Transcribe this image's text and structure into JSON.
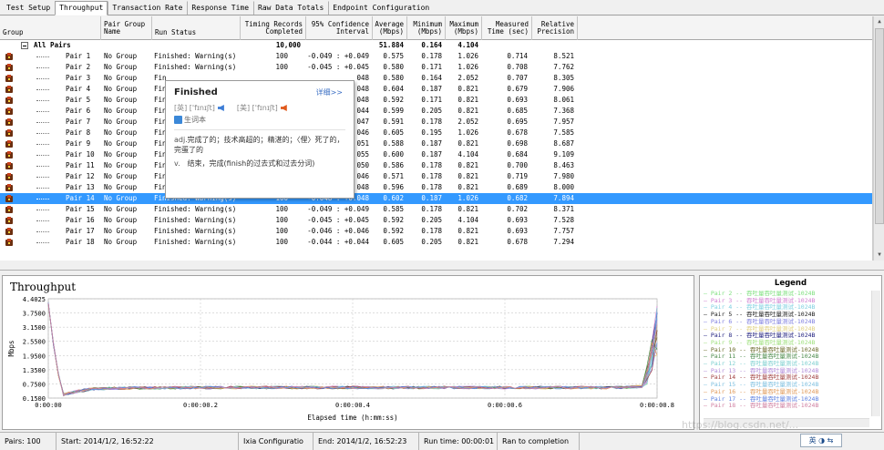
{
  "tabs": [
    "Test Setup",
    "Throughput",
    "Transaction Rate",
    "Response Time",
    "Raw Data Totals",
    "Endpoint Configuration"
  ],
  "columns": {
    "group": "Group",
    "pair_group_name": [
      "Pair Group",
      "Name"
    ],
    "run_status": "Run Status",
    "timing_records": [
      "Timing Records",
      "Completed"
    ],
    "confidence": [
      "95% Confidence",
      "Interval"
    ],
    "average": [
      "Average",
      "(Mbps)"
    ],
    "minimum": [
      "Minimum",
      "(Mbps)"
    ],
    "maximum": [
      "Maximum",
      "(Mbps)"
    ],
    "measured_time": [
      "Measured",
      "Time (sec)"
    ],
    "relative_precision": [
      "Relative",
      "Precision"
    ]
  },
  "all_pairs": {
    "label": "All Pairs",
    "records": "10,000",
    "average": "51.884",
    "minimum": "0.164",
    "maximum": "4.104"
  },
  "rows": [
    {
      "pair": "Pair 1",
      "group": "No Group",
      "status": "Finished: Warning(s)",
      "records": "100",
      "ci": "-0.049 : +0.049",
      "avg": "0.575",
      "min": "0.178",
      "max": "1.026",
      "time": "0.714",
      "prec": "8.521"
    },
    {
      "pair": "Pair 2",
      "group": "No Group",
      "status": "Finished: Warning(s)",
      "records": "100",
      "ci": "-0.045 : +0.045",
      "avg": "0.580",
      "min": "0.171",
      "max": "1.026",
      "time": "0.708",
      "prec": "7.762"
    },
    {
      "pair": "Pair 3",
      "group": "No Group",
      "status": "Fin",
      "records": "",
      "ci": "048",
      "avg": "0.580",
      "min": "0.164",
      "max": "2.052",
      "time": "0.707",
      "prec": "8.305"
    },
    {
      "pair": "Pair 4",
      "group": "No Group",
      "status": "Fin",
      "records": "",
      "ci": "048",
      "avg": "0.604",
      "min": "0.187",
      "max": "0.821",
      "time": "0.679",
      "prec": "7.906"
    },
    {
      "pair": "Pair 5",
      "group": "No Group",
      "status": "Fin",
      "records": "",
      "ci": "048",
      "avg": "0.592",
      "min": "0.171",
      "max": "0.821",
      "time": "0.693",
      "prec": "8.061"
    },
    {
      "pair": "Pair 6",
      "group": "No Group",
      "status": "Fin",
      "records": "",
      "ci": "044",
      "avg": "0.599",
      "min": "0.205",
      "max": "0.821",
      "time": "0.685",
      "prec": "7.368"
    },
    {
      "pair": "Pair 7",
      "group": "No Group",
      "status": "Fin",
      "records": "",
      "ci": "047",
      "avg": "0.591",
      "min": "0.178",
      "max": "2.052",
      "time": "0.695",
      "prec": "7.957"
    },
    {
      "pair": "Pair 8",
      "group": "No Group",
      "status": "Fin",
      "records": "",
      "ci": "046",
      "avg": "0.605",
      "min": "0.195",
      "max": "1.026",
      "time": "0.678",
      "prec": "7.585"
    },
    {
      "pair": "Pair 9",
      "group": "No Group",
      "status": "Fin",
      "records": "",
      "ci": "051",
      "avg": "0.588",
      "min": "0.187",
      "max": "0.821",
      "time": "0.698",
      "prec": "8.687"
    },
    {
      "pair": "Pair 10",
      "group": "No Group",
      "status": "Fin",
      "records": "",
      "ci": "055",
      "avg": "0.600",
      "min": "0.187",
      "max": "4.104",
      "time": "0.684",
      "prec": "9.109"
    },
    {
      "pair": "Pair 11",
      "group": "No Group",
      "status": "Fin",
      "records": "",
      "ci": "050",
      "avg": "0.586",
      "min": "0.178",
      "max": "0.821",
      "time": "0.700",
      "prec": "8.463"
    },
    {
      "pair": "Pair 12",
      "group": "No Group",
      "status": "Fin",
      "records": "",
      "ci": "046",
      "avg": "0.571",
      "min": "0.178",
      "max": "0.821",
      "time": "0.719",
      "prec": "7.980"
    },
    {
      "pair": "Pair 13",
      "group": "No Group",
      "status": "Fin",
      "records": "",
      "ci": "048",
      "avg": "0.596",
      "min": "0.178",
      "max": "0.821",
      "time": "0.689",
      "prec": "8.000"
    },
    {
      "pair": "Pair 14",
      "group": "No Group",
      "status": "Finished: Warning(s)",
      "records": "100",
      "ci": "-0.048 : +0.048",
      "avg": "0.602",
      "min": "0.187",
      "max": "1.026",
      "time": "0.682",
      "prec": "7.894",
      "selected": true
    },
    {
      "pair": "Pair 15",
      "group": "No Group",
      "status": "Finished: Warning(s)",
      "records": "100",
      "ci": "-0.049 : +0.049",
      "avg": "0.585",
      "min": "0.178",
      "max": "0.821",
      "time": "0.702",
      "prec": "8.371"
    },
    {
      "pair": "Pair 16",
      "group": "No Group",
      "status": "Finished: Warning(s)",
      "records": "100",
      "ci": "-0.045 : +0.045",
      "avg": "0.592",
      "min": "0.205",
      "max": "4.104",
      "time": "0.693",
      "prec": "7.528"
    },
    {
      "pair": "Pair 17",
      "group": "No Group",
      "status": "Finished: Warning(s)",
      "records": "100",
      "ci": "-0.046 : +0.046",
      "avg": "0.592",
      "min": "0.178",
      "max": "0.821",
      "time": "0.693",
      "prec": "7.757"
    },
    {
      "pair": "Pair 18",
      "group": "No Group",
      "status": "Finished: Warning(s)",
      "records": "100",
      "ci": "-0.044 : +0.044",
      "avg": "0.605",
      "min": "0.205",
      "max": "0.821",
      "time": "0.678",
      "prec": "7.294"
    }
  ],
  "tooltip": {
    "word": "Finished",
    "more": "详细>>",
    "uk": "[英] ['fɪnɪʃt]",
    "us": "[美] ['fɪnɪʃt]",
    "vocab": "生词本",
    "adj_pos": "adj.",
    "adj_def": "完成了的；技术高超的；精湛的；〈俚〉死了的，完蛋了的",
    "v_pos": "v.",
    "v_def": "结束，完成(finish的过去式和过去分词)"
  },
  "chart_data": {
    "type": "line",
    "title": "Throughput",
    "xlabel": "Elapsed time (h:mm:ss)",
    "ylabel": "Mbps",
    "y_ticks": [
      "4.4025",
      "3.7500",
      "3.1500",
      "2.5500",
      "1.9500",
      "1.3500",
      "0.7500",
      "0.1500"
    ],
    "x_ticks": [
      "0:00:00",
      "0:00:00.2",
      "0:00:00.4",
      "0:00:00.6",
      "0:00:00.8"
    ],
    "ylim": [
      0.15,
      4.4025
    ],
    "xlim": [
      0,
      0.8
    ],
    "series_profile": {
      "x": [
        0.0,
        0.01,
        0.02,
        0.04,
        0.06,
        0.1,
        0.2,
        0.3,
        0.4,
        0.5,
        0.6,
        0.65,
        0.7,
        0.75,
        0.78,
        0.79,
        0.8
      ],
      "y": [
        4.2,
        1.6,
        0.3,
        0.45,
        0.55,
        0.58,
        0.6,
        0.6,
        0.6,
        0.6,
        0.6,
        0.6,
        0.6,
        0.6,
        0.65,
        1.8,
        3.9
      ]
    },
    "grid": true
  },
  "legend": {
    "title": "Legend",
    "items": [
      {
        "label": "Pair 2 -- 吞吐量吞吐量测试-1024B",
        "color": "#7fe07f"
      },
      {
        "label": "Pair 3 -- 吞吐量吞吐量测试-1024B",
        "color": "#d07fd0"
      },
      {
        "label": "Pair 4 -- 吞吐量吞吐量测试-1024B",
        "color": "#7fd0e0"
      },
      {
        "label": "Pair 5 -- 吞吐量吞吐量测试-1024B",
        "color": "#202020"
      },
      {
        "label": "Pair 6 -- 吞吐量吞吐量测试-1024B",
        "color": "#7f7fe0"
      },
      {
        "label": "Pair 7 -- 吞吐量吞吐量测试-1024B",
        "color": "#e0d07f"
      },
      {
        "label": "Pair 8 -- 吞吐量吞吐量测试-1024B",
        "color": "#20207f"
      },
      {
        "label": "Pair 9 -- 吞吐量吞吐量测试-1024B",
        "color": "#a0e07f"
      },
      {
        "label": "Pair 10 -- 吞吐量吞吐量测试-1024B",
        "color": "#6a6a2a"
      },
      {
        "label": "Pair 11 -- 吞吐量吞吐量测试-1024B",
        "color": "#4a8a4a"
      },
      {
        "label": "Pair 12 -- 吞吐量吞吐量测试-1024B",
        "color": "#7fd0d0"
      },
      {
        "label": "Pair 13 -- 吞吐量吞吐量测试-1024B",
        "color": "#b08ad8"
      },
      {
        "label": "Pair 14 -- 吞吐量吞吐量测试-1024B",
        "color": "#a04040"
      },
      {
        "label": "Pair 15 -- 吞吐量吞吐量测试-1024B",
        "color": "#7fc0e0"
      },
      {
        "label": "Pair 16 -- 吞吐量吞吐量测试-1024B",
        "color": "#e09a5a"
      },
      {
        "label": "Pair 17 -- 吞吐量吞吐量测试-1024B",
        "color": "#5a7fe0"
      },
      {
        "label": "Pair 18 -- 吞吐量吞吐量测试-1024B",
        "color": "#d07fa0"
      }
    ]
  },
  "status_bar": {
    "pairs": "Pairs: 100",
    "start": "Start: 2014/1/2, 16:52:22",
    "config": "Ixia Configuratio",
    "end": "End: 2014/1/2, 16:52:23",
    "run_time": "Run time: 00:00:01",
    "completion": "Ran to completion"
  },
  "ime": "英 ◑ ⇆",
  "watermark": "https://blog.csdn.net/..."
}
